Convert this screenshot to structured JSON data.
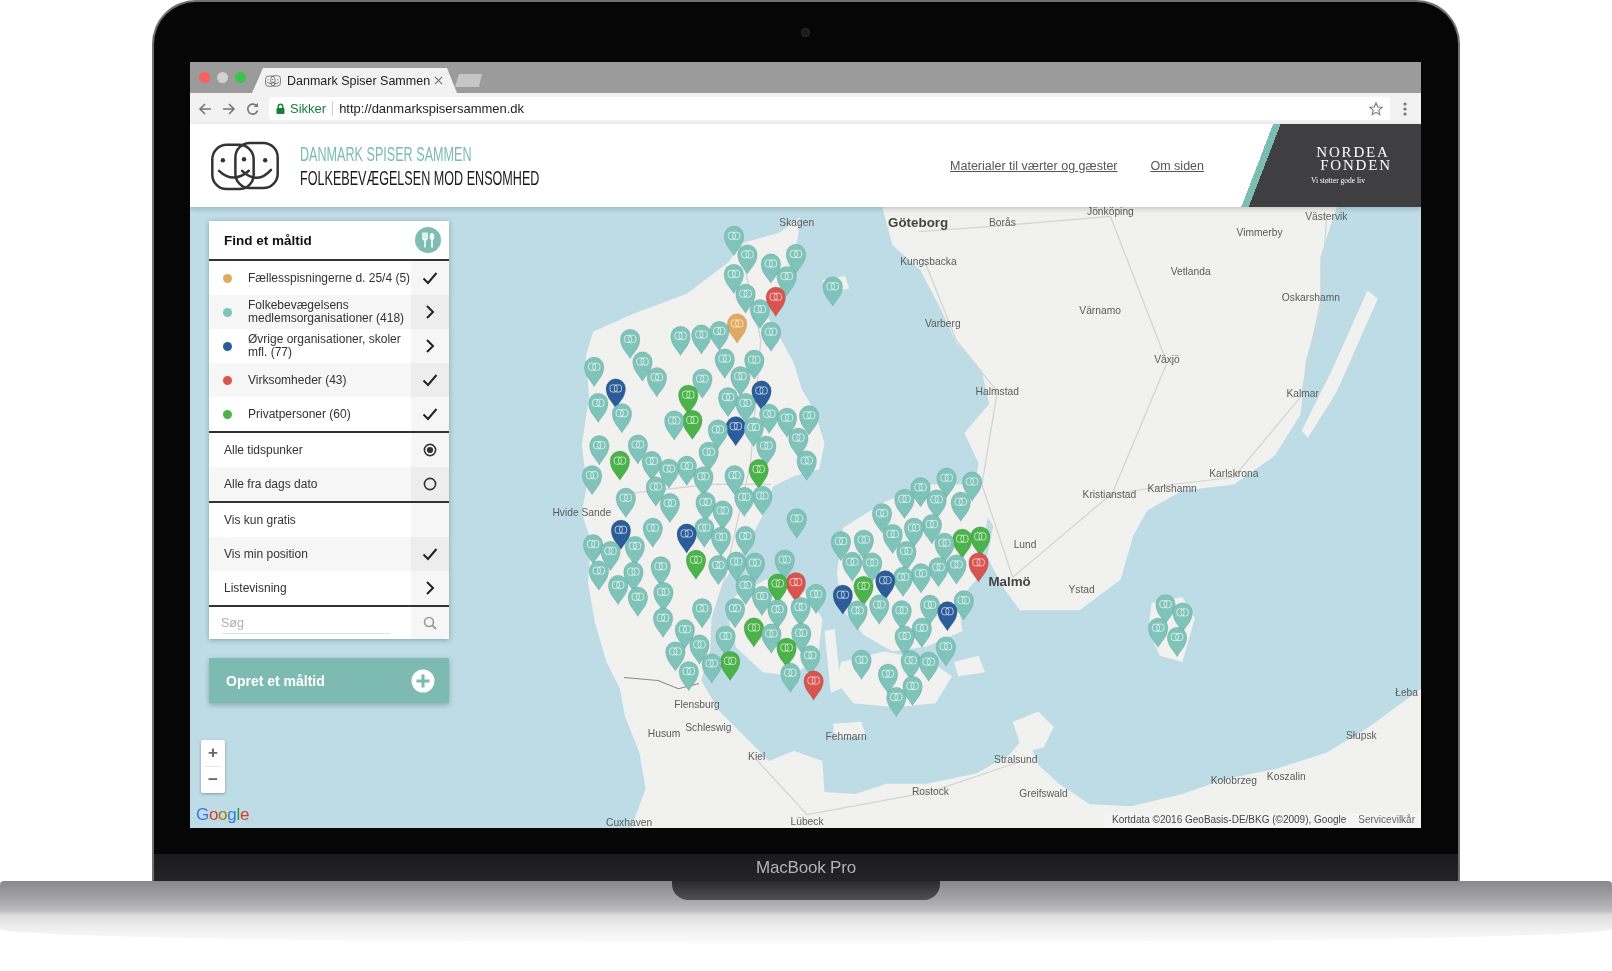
{
  "laptop": {
    "model_label": "MacBook Pro"
  },
  "browser": {
    "tabs": [
      {
        "title": "Danmark Spiser Sammen",
        "selected": true
      }
    ],
    "security_label": "Sikker",
    "url": "http://danmarkspisersammen.dk"
  },
  "header": {
    "title": "DANMARK SPISER SAMMEN",
    "subtitle": "FOLKEBEVÆGELSEN MOD ENSOMHED",
    "links": [
      {
        "label": "Materialer til værter og gæster"
      },
      {
        "label": "Om siden"
      }
    ],
    "sponsor": {
      "wordmark": [
        "NORDEA",
        "FONDEN"
      ],
      "tagline": "Vi støtter gode liv"
    }
  },
  "filter_panel": {
    "title": "Find et måltid",
    "categories": [
      {
        "label": "Fællesspisningerne d. 25/4 (5)",
        "color": "#e0a95e",
        "kind": "toggle",
        "checked": true
      },
      {
        "label": "Folkebevægelsens medlemsorganisationer (418)",
        "color": "#7fc4ba",
        "kind": "submenu"
      },
      {
        "label": "Øvrige organisationer, skoler mfl. (77)",
        "color": "#2b5d9b",
        "kind": "submenu"
      },
      {
        "label": "Virksomheder (43)",
        "color": "#d9534f",
        "kind": "toggle",
        "checked": true
      },
      {
        "label": "Privatpersoner (60)",
        "color": "#4cb24a",
        "kind": "toggle",
        "checked": true
      }
    ],
    "time_options": [
      {
        "label": "Alle tidspunker",
        "selected": true
      },
      {
        "label": "Alle fra dags dato",
        "selected": false
      }
    ],
    "options": [
      {
        "label": "Vis kun gratis",
        "kind": "toggle",
        "checked": false
      },
      {
        "label": "Vis min position",
        "kind": "toggle",
        "checked": true
      },
      {
        "label": "Listevisning",
        "kind": "submenu"
      }
    ],
    "search": {
      "placeholder": "Søg"
    }
  },
  "create_button": {
    "label": "Opret et måltid"
  },
  "map": {
    "place_labels": [
      {
        "text": "Skagen",
        "kind": "town"
      },
      {
        "text": "Göteborg",
        "kind": "city"
      },
      {
        "text": "Borås",
        "kind": "town"
      },
      {
        "text": "Jönköping",
        "kind": "town"
      },
      {
        "text": "Västervik",
        "kind": "town"
      },
      {
        "text": "Vimmerby",
        "kind": "town"
      },
      {
        "text": "Kungsbacka",
        "kind": "town"
      },
      {
        "text": "Vetlanda",
        "kind": "town"
      },
      {
        "text": "Oskarshamn",
        "kind": "town"
      },
      {
        "text": "Värnamo",
        "kind": "town"
      },
      {
        "text": "Varberg",
        "kind": "town"
      },
      {
        "text": "Växjö",
        "kind": "town"
      },
      {
        "text": "Halmstad",
        "kind": "town"
      },
      {
        "text": "Kalmar",
        "kind": "town"
      },
      {
        "text": "Karlskrona",
        "kind": "town"
      },
      {
        "text": "Karlshamn",
        "kind": "town"
      },
      {
        "text": "Kristianstad",
        "kind": "town"
      },
      {
        "text": "Lund",
        "kind": "town"
      },
      {
        "text": "Malmö",
        "kind": "city"
      },
      {
        "text": "Ystad",
        "kind": "town"
      },
      {
        "text": "Hvide Sande",
        "kind": "town"
      },
      {
        "text": "Flensburg",
        "kind": "town"
      },
      {
        "text": "Husum",
        "kind": "town"
      },
      {
        "text": "Schleswig",
        "kind": "town"
      },
      {
        "text": "Kiel",
        "kind": "town"
      },
      {
        "text": "Fehmarn",
        "kind": "town"
      },
      {
        "text": "Stralsund",
        "kind": "town"
      },
      {
        "text": "Rostock",
        "kind": "town"
      },
      {
        "text": "Greifswald",
        "kind": "town"
      },
      {
        "text": "Słupsk",
        "kind": "town"
      },
      {
        "text": "Kołobrzeg",
        "kind": "town"
      },
      {
        "text": "Koszalin",
        "kind": "town"
      },
      {
        "text": "Łeba",
        "kind": "town"
      },
      {
        "text": "Lübeck",
        "kind": "town"
      },
      {
        "text": "Cuxhaven",
        "kind": "town"
      }
    ],
    "zoom_in": "+",
    "zoom_out": "−",
    "logo": "Google",
    "attribution": "Kortdata ©2016 GeoBasis-DE/BKG (©2009), Google",
    "terms_link": "Servicevilkår"
  }
}
